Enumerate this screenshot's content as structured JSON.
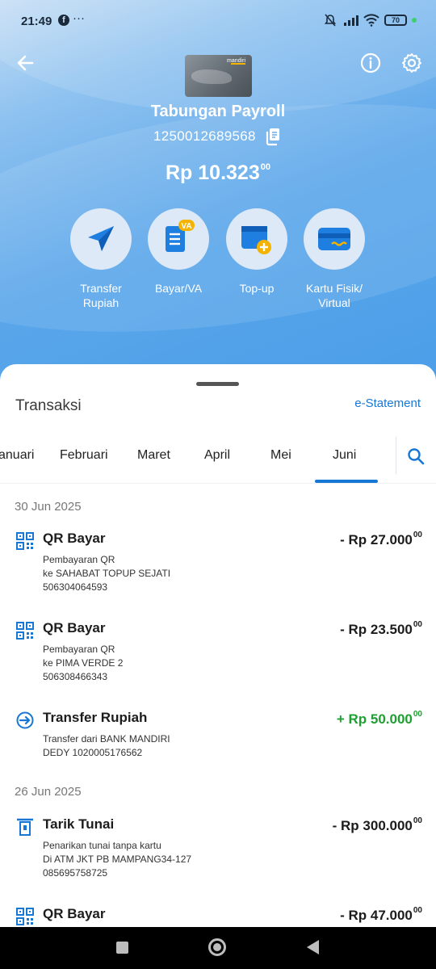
{
  "status_bar": {
    "time": "21:49",
    "more": "···",
    "battery": "70"
  },
  "account": {
    "name": "Tabungan Payroll",
    "number": "1250012689568",
    "balance_main": "Rp 10.323",
    "balance_cents": "00",
    "card_brand": "mandiri"
  },
  "actions": [
    {
      "line1": "Transfer",
      "line2": "Rupiah",
      "icon": "paper-plane-icon"
    },
    {
      "line1": "Bayar/VA",
      "line2": "",
      "icon": "bill-va-icon",
      "badge": "VA"
    },
    {
      "line1": "Top-up",
      "line2": "",
      "icon": "wallet-plus-icon"
    },
    {
      "line1": "Kartu Fisik/",
      "line2": "Virtual",
      "icon": "card-icon"
    }
  ],
  "transactions_section": {
    "title": "Transaksi",
    "statement_link": "e-Statement",
    "months": [
      "anuari",
      "Februari",
      "Maret",
      "April",
      "Mei",
      "Juni"
    ],
    "active_month": "Juni"
  },
  "groups": [
    {
      "date": "30 Jun 2025",
      "items": [
        {
          "type": "QR Bayar",
          "amount": "- Rp 27.000",
          "cents": "00",
          "lines": [
            "Pembayaran QR",
            "ke SAHABAT TOPUP SEJATI",
            "506304064593"
          ]
        },
        {
          "type": "QR Bayar",
          "amount": "- Rp 23.500",
          "cents": "00",
          "lines": [
            "Pembayaran QR",
            "ke PIMA VERDE 2",
            "506308466343"
          ]
        },
        {
          "type": "Transfer Rupiah",
          "amount": "+ Rp 50.000",
          "cents": "00",
          "lines": [
            "Transfer dari BANK MANDIRI",
            "DEDY 1020005176562"
          ]
        }
      ]
    },
    {
      "date": "26 Jun 2025",
      "items": [
        {
          "type": "Tarik Tunai",
          "amount": "- Rp 300.000",
          "cents": "00",
          "lines": [
            "Penarikan tunai tanpa kartu",
            "Di ATM JKT PB MAMPANG34-127",
            "085695758725"
          ]
        },
        {
          "type": "QR Bayar",
          "amount": "- Rp 47.000",
          "cents": "00",
          "lines": []
        }
      ]
    }
  ],
  "colors": {
    "accent": "#1777d4",
    "positive": "#1ea031",
    "hero": "#4a9ee8"
  }
}
